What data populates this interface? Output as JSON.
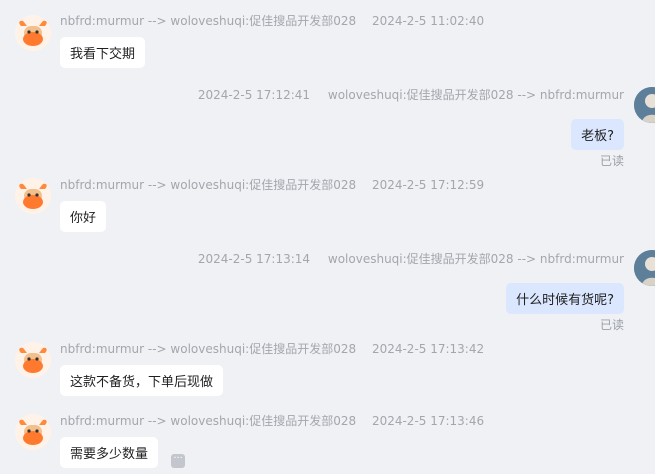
{
  "messages": [
    {
      "direction": "in",
      "sender": "nbfrd:murmur --> woloveshuqi:促佳搜品开发部028",
      "time": "2024-2-5 11:02:40",
      "text": "我看下交期"
    },
    {
      "direction": "out",
      "sender": "woloveshuqi:促佳搜品开发部028 --> nbfrd:murmur",
      "time": "2024-2-5 17:12:41",
      "text": "老板?",
      "status": "已读"
    },
    {
      "direction": "in",
      "sender": "nbfrd:murmur --> woloveshuqi:促佳搜品开发部028",
      "time": "2024-2-5 17:12:59",
      "text": "你好"
    },
    {
      "direction": "out",
      "sender": "woloveshuqi:促佳搜品开发部028 --> nbfrd:murmur",
      "time": "2024-2-5 17:13:14",
      "text": "什么时候有货呢?",
      "status": "已读"
    },
    {
      "direction": "in",
      "sender": "nbfrd:murmur --> woloveshuqi:促佳搜品开发部028",
      "time": "2024-2-5 17:13:42",
      "text": "这款不备货，下单后现做"
    },
    {
      "direction": "in",
      "sender": "nbfrd:murmur --> woloveshuqi:促佳搜品开发部028",
      "time": "2024-2-5 17:13:46",
      "text": "需要多少数量"
    }
  ],
  "icons": {
    "incoming_avatar": "bull-mascot-avatar",
    "outgoing_avatar": "user-photo-avatar",
    "more": "more-icon"
  },
  "more_label": "···",
  "colors": {
    "background": "#f0f1f5",
    "incoming_bubble": "#ffffff",
    "outgoing_bubble": "#dbe7ff",
    "meta_text": "#a3a6ad"
  }
}
